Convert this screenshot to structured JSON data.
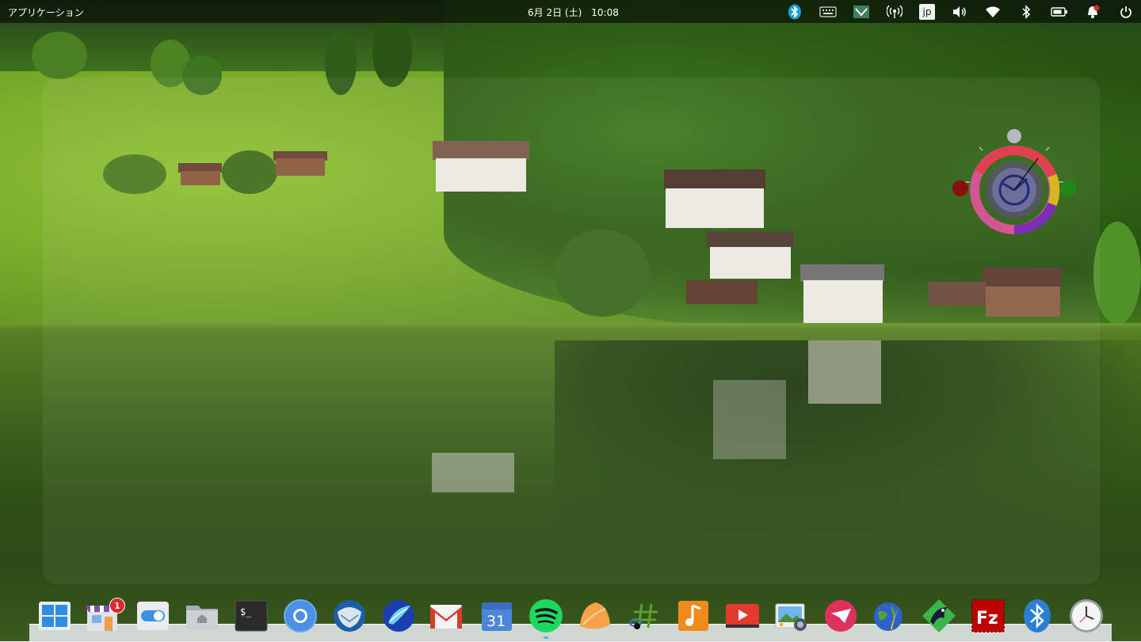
{
  "top_panel": {
    "apps_menu_label": "アプリケーション",
    "datetime": "6月 2日 (土)　10:08",
    "keyboard_layout": "jp",
    "indicators": [
      "bluetooth-app-icon",
      "keyboard-icon",
      "network-map-icon",
      "wireless-broadcast-icon",
      "keyboard-layout-icon",
      "volume-icon",
      "wifi-icon",
      "bluetooth-icon",
      "battery-icon",
      "notifications-icon",
      "power-icon"
    ]
  },
  "dock": {
    "items": [
      {
        "name": "multitasking-view",
        "icon": "multitasking-view-icon"
      },
      {
        "name": "appcenter",
        "icon": "appcenter-icon",
        "badge": "1"
      },
      {
        "name": "system-settings",
        "icon": "settings-toggle-icon"
      },
      {
        "name": "files",
        "icon": "home-folder-icon"
      },
      {
        "name": "terminal",
        "icon": "terminal-icon",
        "label": "$_"
      },
      {
        "name": "chromium",
        "icon": "chromium-icon"
      },
      {
        "name": "thunderbird",
        "icon": "thunderbird-icon"
      },
      {
        "name": "midori-browser",
        "icon": "midori-icon"
      },
      {
        "name": "gmail",
        "icon": "gmail-icon"
      },
      {
        "name": "calendar",
        "icon": "calendar-icon",
        "label": "31"
      },
      {
        "name": "spotify",
        "icon": "spotify-icon",
        "running": true
      },
      {
        "name": "slack-like-app",
        "icon": "orange-leaf-icon"
      },
      {
        "name": "music-tag-editor",
        "icon": "music-hash-icon"
      },
      {
        "name": "music",
        "icon": "music-note-icon"
      },
      {
        "name": "youtube",
        "icon": "video-player-icon"
      },
      {
        "name": "photos",
        "icon": "photos-icon"
      },
      {
        "name": "mailspring",
        "icon": "mail-app-icon"
      },
      {
        "name": "quill-writer",
        "icon": "globe-quill-icon"
      },
      {
        "name": "kodi-like-app",
        "icon": "raven-icon"
      },
      {
        "name": "filezilla",
        "icon": "filezilla-icon",
        "label": "Fz"
      },
      {
        "name": "bluetooth-manager",
        "icon": "bluetooth-app-icon"
      },
      {
        "name": "clock",
        "icon": "clock-icon"
      }
    ]
  },
  "colors": {
    "panel_bg": "#000000",
    "badge": "#e0262e",
    "running_indicator": "#3bbcf0",
    "clock_ring": [
      "#e0414f",
      "#d9b520",
      "#7a2fb5",
      "#d35591"
    ]
  }
}
